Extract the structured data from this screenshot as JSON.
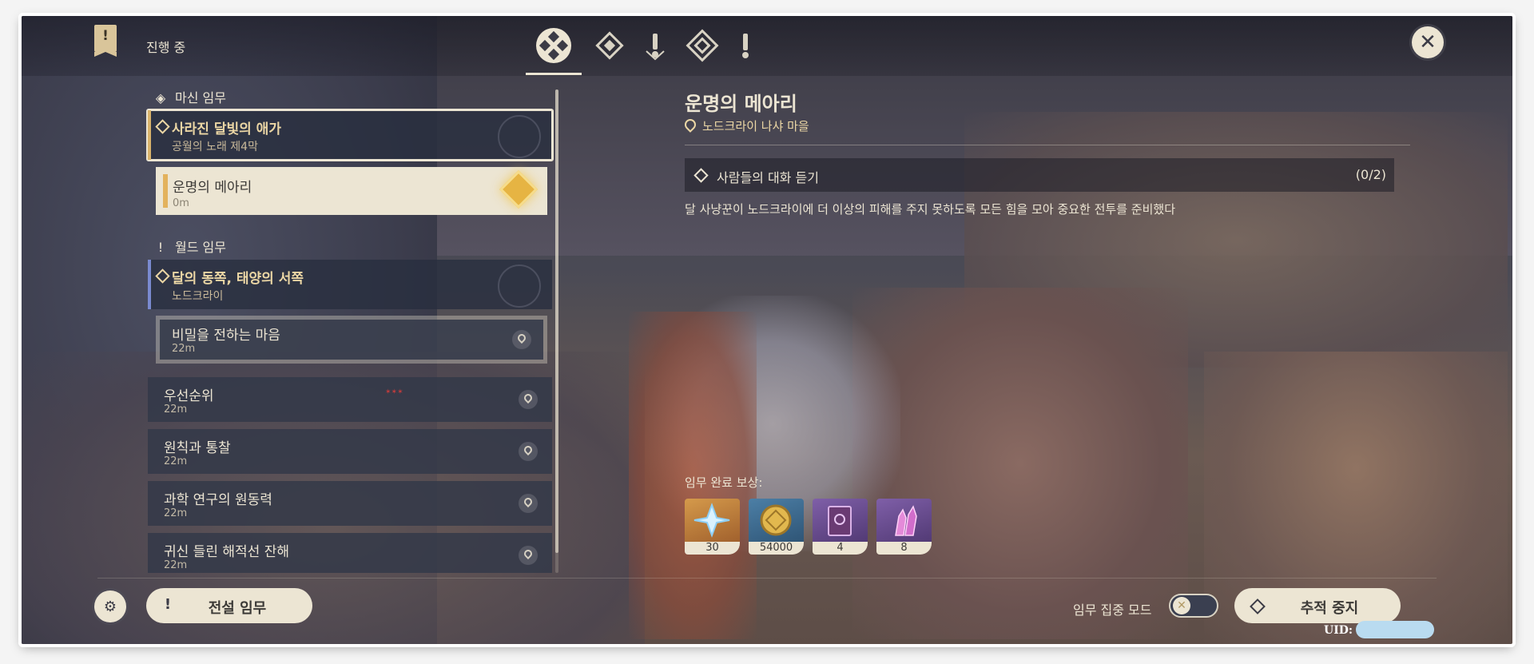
{
  "header": {
    "title": "진행 중",
    "tabs": [
      {
        "name": "all-quests-tab",
        "active": true
      },
      {
        "name": "archon-quests-tab",
        "active": false
      },
      {
        "name": "story-quests-tab",
        "active": false
      },
      {
        "name": "commission-quests-tab",
        "active": false
      },
      {
        "name": "world-quests-tab",
        "active": false
      }
    ]
  },
  "quest_list": {
    "archon_section": "마신 임무",
    "archon_parent": {
      "title": "사라진 달빛의 애가",
      "subtitle": "공월의 노래 제4막"
    },
    "archon_active_sub": {
      "title": "운명의 메아리",
      "distance": "0m"
    },
    "world_section": "월드 임무",
    "world_parent": {
      "title": "달의 동쪽, 태양의 서쪽",
      "subtitle": "노드크라이"
    },
    "world_sub": {
      "title": "비밀을 전하는 마음",
      "distance": "22m"
    },
    "rows": [
      {
        "title": "우선순위",
        "distance": "22m"
      },
      {
        "title": "원칙과 통찰",
        "distance": "22m"
      },
      {
        "title": "과학 연구의 원동력",
        "distance": "22m"
      },
      {
        "title": "귀신 들린 해적선 잔해",
        "distance": "22m"
      }
    ]
  },
  "details": {
    "title": "운명의 메아리",
    "location": "노드크라이 나샤 마을",
    "objective": {
      "text": "사람들의 대화 듣기",
      "progress": "(0/2)"
    },
    "description": "달 사냥꾼이 노드크라이에 더 이상의 피해를 주지 못하도록 모든 힘을 모아 중요한 전투를 준비했다",
    "reward_label": "임무 완료 보상:",
    "rewards": [
      {
        "icon": "primogem-icon",
        "count": "30",
        "color": "#c9813a"
      },
      {
        "icon": "mora-icon",
        "count": "54000",
        "color": "#3b6e93"
      },
      {
        "icon": "book-icon",
        "count": "4",
        "color": "#6b4c8a"
      },
      {
        "icon": "crystal-icon",
        "count": "8",
        "color": "#6b4c8a"
      }
    ]
  },
  "bottom": {
    "legend_button": "전설 임무",
    "focus_mode_label": "임무 집중 모드",
    "track_button": "추적 중지",
    "uid_label": "UID:"
  },
  "colors": {
    "accent_gold": "#ecd7a5",
    "cream": "#ece5d3",
    "archon_accent": "#d9b36b",
    "world_accent": "#7a8ad0"
  }
}
